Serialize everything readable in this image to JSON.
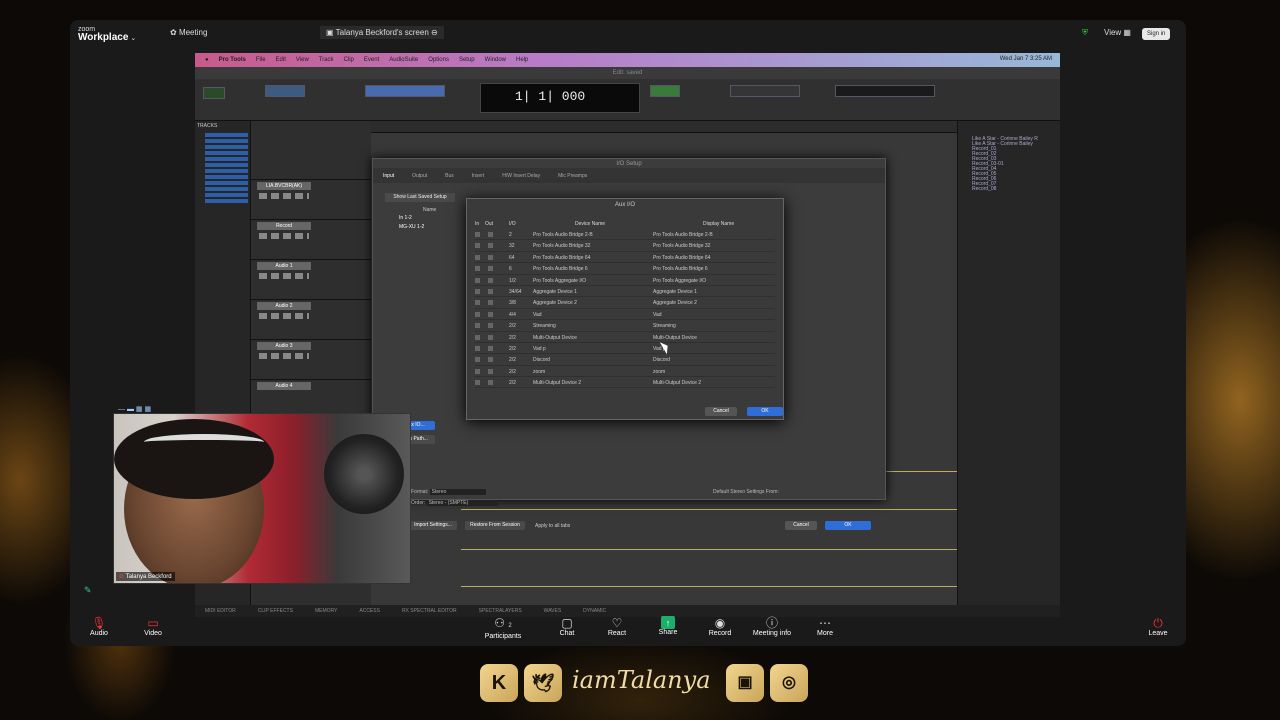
{
  "zoom": {
    "brand_top": "zoom",
    "brand_main": "Workplace",
    "meeting": "Meeting",
    "screen_title": "Talanya Beckford's screen",
    "view": "View",
    "signin": "Sign in"
  },
  "protools": {
    "app": "Pro Tools",
    "menus": [
      "File",
      "Edit",
      "View",
      "Track",
      "Clip",
      "Event",
      "AudioSuite",
      "Options",
      "Setup",
      "Window",
      "Help"
    ],
    "date": "Wed Jan 7 3:25 AM",
    "edit_title": "Edit: saved",
    "counter": "1| 1| 000",
    "tracks_header": "TRACKS",
    "clips_header": "CLIPS",
    "clips": [
      "Like A Star - Corinne Bailey R",
      "Like A Star - Corinne Bailey",
      "Record_01",
      "Record_02",
      "Record_03",
      "Record_03-01",
      "Record_04",
      "Record_05",
      "Record_06",
      "Record_07",
      "Record_08"
    ]
  },
  "mix_tracks": [
    "LIA.BVCBR(AK)",
    "Record",
    "Audio 1",
    "Audio 2",
    "Audio 3",
    "Audio 4"
  ],
  "io_setup": {
    "title": "I/O Setup",
    "tabs": [
      "Input",
      "Output",
      "Bus",
      "Insert",
      "H/W Insert Delay",
      "Mic Preamps"
    ],
    "show_last": "Show Last Saved Setup",
    "col_name": "Name",
    "aux_btn": "Aux IO...",
    "new_path": "New Path...",
    "format_label": "Format:",
    "format_value": "Stereo",
    "order_label": "Order:",
    "order_value": "Stereo - (SMPTE)",
    "default_label": "Default Stereo Settings From:",
    "import": "Import Settings...",
    "restore": "Restore From Session",
    "apply": "Apply to all tabs",
    "cancel": "Cancel",
    "ok": "OK",
    "inputs": [
      "In 1-2",
      "MG-XU 1-2"
    ]
  },
  "aux_io": {
    "title": "Aux I/O",
    "cols": {
      "in": "In",
      "out": "Out",
      "io": "I/O",
      "device": "Device Name",
      "display": "Display Name"
    },
    "rows": [
      {
        "io": "2",
        "device": "Pro Tools Audio Bridge 2-B",
        "display": "Pro Tools Audio Bridge 2-B"
      },
      {
        "io": "32",
        "device": "Pro Tools Audio Bridge 32",
        "display": "Pro Tools Audio Bridge 32"
      },
      {
        "io": "64",
        "device": "Pro Tools Audio Bridge 64",
        "display": "Pro Tools Audio Bridge 64"
      },
      {
        "io": "6",
        "device": "Pro Tools Audio Bridge 6",
        "display": "Pro Tools Audio Bridge 6"
      },
      {
        "io": "1/2",
        "device": "Pro Tools Aggregate I/O",
        "display": "Pro Tools Aggregate I/O"
      },
      {
        "io": "34/64",
        "device": "Aggregate Device 1",
        "display": "Aggregate Device 1"
      },
      {
        "io": "3/8",
        "device": "Aggregate Device 2",
        "display": "Aggregate Device 2"
      },
      {
        "io": "4/4",
        "device": "Vad",
        "display": "Vad"
      },
      {
        "io": "2/2",
        "device": "Streaming",
        "display": "Streaming"
      },
      {
        "io": "2/2",
        "device": "Multi-Output Device",
        "display": "Multi-Output Device"
      },
      {
        "io": "2/2",
        "device": "Vad p",
        "display": "Vad p"
      },
      {
        "io": "2/2",
        "device": "Discord",
        "display": "Discord"
      },
      {
        "io": "2/2",
        "device": "zoom",
        "display": "zoom"
      },
      {
        "io": "2/2",
        "device": "Multi-Output Device 2",
        "display": "Multi-Output Device 2"
      }
    ],
    "cancel": "Cancel",
    "ok": "OK"
  },
  "status": [
    "MIDI EDITOR",
    "CLIP EFFECTS",
    "MEMORY",
    "ACCESS",
    "RX SPECTRAL EDITOR",
    "SPECTRALAYERS",
    "WAVES",
    "DYNAMIC"
  ],
  "camera": {
    "name": "Talanya Beckford"
  },
  "bottom": {
    "audio": "Audio",
    "video": "Video",
    "participants": "Participants",
    "participants_count": "2",
    "chat": "Chat",
    "react": "React",
    "share": "Share",
    "record": "Record",
    "info": "Meeting info",
    "more": "More",
    "leave": "Leave"
  },
  "brand": {
    "handle": "iamTalanya"
  }
}
